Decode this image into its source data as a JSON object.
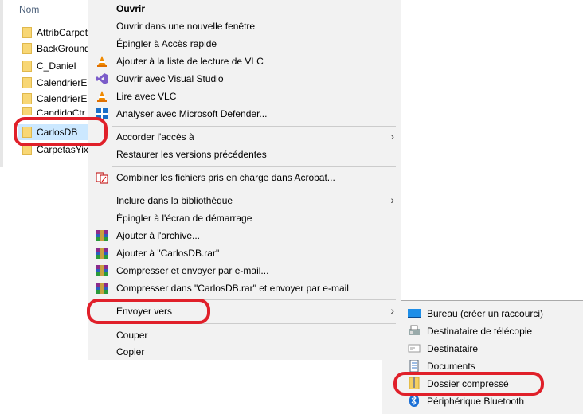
{
  "explorer": {
    "column_header": "Nom",
    "rows": [
      {
        "name": "AttribCarpet",
        "selected": false
      },
      {
        "name": "BackGround",
        "selected": false
      },
      {
        "name": "C_Daniel",
        "selected": false
      },
      {
        "name": "CalendrierES",
        "selected": false
      },
      {
        "name": "CalendrierES",
        "selected": false
      },
      {
        "name": "CandidoCtr",
        "selected": false
      },
      {
        "name": "CarlosDB",
        "selected": true
      },
      {
        "name": "CarpetasYix",
        "selected": false
      }
    ]
  },
  "context_menu": {
    "items": [
      {
        "label": "Ouvrir",
        "icon": "none",
        "bold": true
      },
      {
        "label": "Ouvrir dans une nouvelle fenêtre",
        "icon": "none"
      },
      {
        "label": "Épingler à Accès rapide",
        "icon": "none"
      },
      {
        "label": "Ajouter à la liste de lecture de VLC",
        "icon": "vlc-icon"
      },
      {
        "label": "Ouvrir avec Visual Studio",
        "icon": "visual-studio-icon"
      },
      {
        "label": "Lire avec VLC",
        "icon": "vlc-icon"
      },
      {
        "label": "Analyser avec Microsoft Defender...",
        "icon": "defender-icon"
      },
      {
        "label": "Accorder l'accès à",
        "icon": "none",
        "submenu": true
      },
      {
        "label": "Restaurer les versions précédentes",
        "icon": "none"
      },
      {
        "label": "Combiner les fichiers pris en charge dans Acrobat...",
        "icon": "acrobat-icon"
      },
      {
        "label": "Inclure dans la bibliothèque",
        "icon": "none",
        "submenu": true
      },
      {
        "label": "Épingler à l'écran de démarrage",
        "icon": "none"
      },
      {
        "label": "Ajouter à l'archive...",
        "icon": "winrar-icon"
      },
      {
        "label": "Ajouter à \"CarlosDB.rar\"",
        "icon": "winrar-icon"
      },
      {
        "label": "Compresser et envoyer par e-mail...",
        "icon": "winrar-icon"
      },
      {
        "label": "Compresser dans \"CarlosDB.rar\" et envoyer par e-mail",
        "icon": "winrar-icon"
      },
      {
        "label": "Envoyer vers",
        "icon": "none",
        "submenu": true
      },
      {
        "label": "Couper",
        "icon": "none"
      },
      {
        "label": "Copier",
        "icon": "none"
      }
    ]
  },
  "send_to_submenu": {
    "items": [
      {
        "label": "Bureau (créer un raccourci)",
        "icon": "desktop-icon"
      },
      {
        "label": "Destinataire de télécopie",
        "icon": "fax-icon"
      },
      {
        "label": "Destinataire",
        "icon": "mail-icon"
      },
      {
        "label": "Documents",
        "icon": "documents-icon"
      },
      {
        "label": "Dossier compressé",
        "icon": "zip-folder-icon"
      },
      {
        "label": "Périphérique Bluetooth",
        "icon": "bluetooth-icon"
      }
    ]
  },
  "colors": {
    "highlight_ring": "#e0202a",
    "selection": "#cce8ff",
    "menu_bg": "#f2f2f2"
  }
}
